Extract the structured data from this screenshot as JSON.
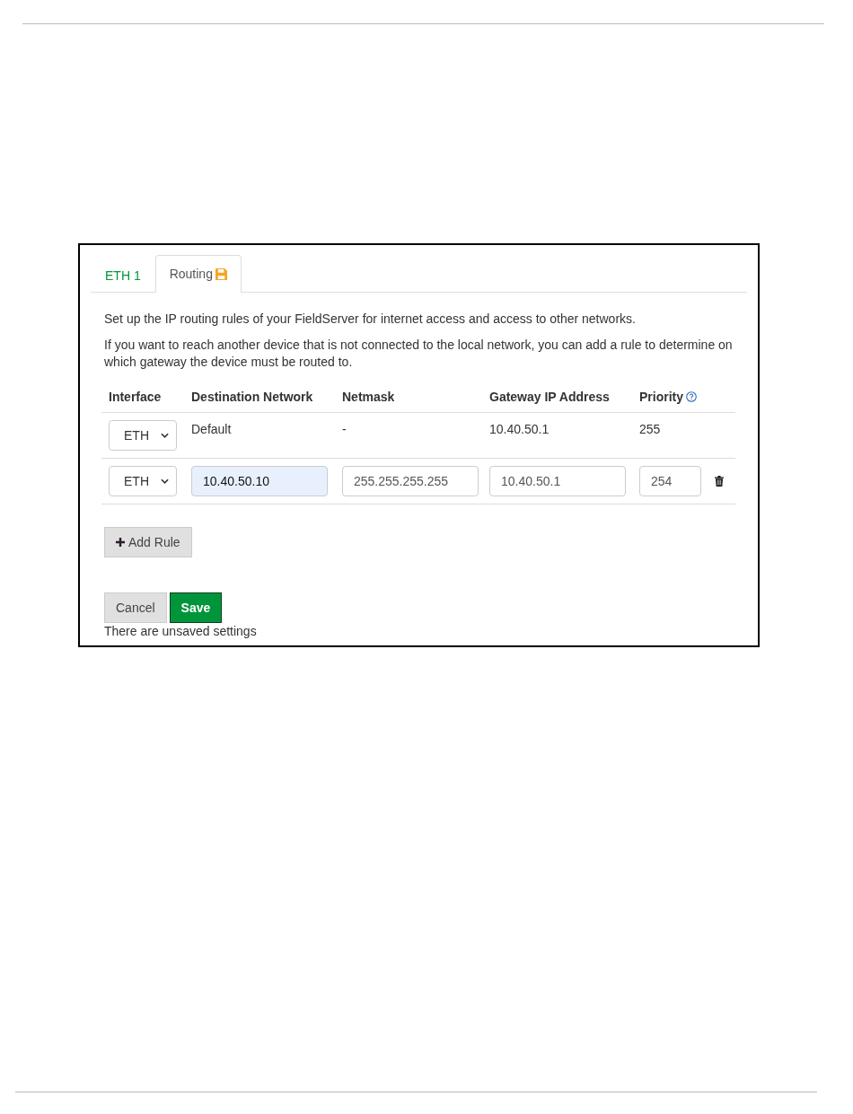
{
  "tabs": [
    {
      "label": "ETH 1",
      "selected": false,
      "unsaved": false
    },
    {
      "label": "Routing",
      "selected": true,
      "unsaved": true
    }
  ],
  "intro": [
    "Set up the IP routing rules of your FieldServer for internet access and access to other networks.",
    "If you want to reach another device that is not connected to the local network, you can add a rule to determine on which gateway the device must be routed to."
  ],
  "table": {
    "columns": [
      "Interface",
      "Destination Network",
      "Netmask",
      "Gateway IP Address",
      "Priority"
    ],
    "rows": [
      {
        "kind": "static",
        "interface": "ETH",
        "destination": "Default",
        "netmask": "-",
        "gateway": "10.40.50.1",
        "priority": "255"
      },
      {
        "kind": "editable",
        "interface": "ETH",
        "destination": "10.40.50.10",
        "destination_highlighted": true,
        "netmask": "255.255.255.255",
        "gateway": "10.40.50.1",
        "priority": "254"
      }
    ]
  },
  "add_button": "Add Rule",
  "buttons": [
    {
      "kind": "cancel",
      "label": "Cancel"
    },
    {
      "kind": "save",
      "label": "Save"
    }
  ],
  "status": "There are unsaved settings"
}
